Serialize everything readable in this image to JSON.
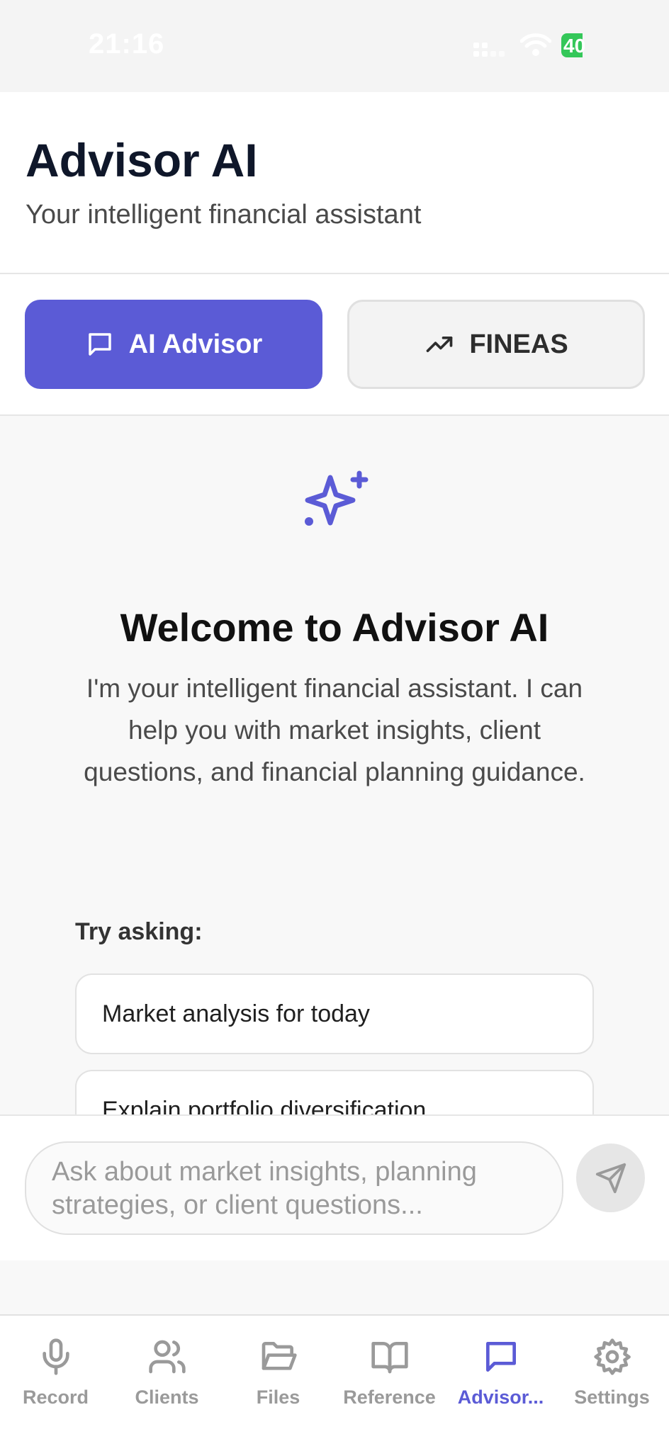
{
  "status_bar": {
    "time": "21:16",
    "battery": "40"
  },
  "header": {
    "title": "Advisor AI",
    "subtitle": "Your intelligent financial assistant"
  },
  "tabs": [
    {
      "label": "AI Advisor",
      "icon": "message-square-icon",
      "active": true
    },
    {
      "label": "FINEAS",
      "icon": "trending-up-icon",
      "active": false
    }
  ],
  "welcome": {
    "icon": "sparkle-icon",
    "title": "Welcome to Advisor AI",
    "text": "I'm your intelligent financial assistant. I can help you with market insights, client questions, and financial planning guidance."
  },
  "suggestions": {
    "label": "Try asking:",
    "items": [
      "Market analysis for today",
      "Explain portfolio diversification"
    ]
  },
  "composer": {
    "placeholder": "Ask about market insights, planning strategies, or client questions...",
    "send_icon": "send-icon"
  },
  "nav": {
    "items": [
      {
        "label": "Record",
        "icon": "mic-icon"
      },
      {
        "label": "Clients",
        "icon": "users-icon"
      },
      {
        "label": "Files",
        "icon": "folder-open-icon"
      },
      {
        "label": "Reference",
        "icon": "book-open-icon"
      },
      {
        "label": "Advisor...",
        "icon": "message-square-icon",
        "active": true
      },
      {
        "label": "Settings",
        "icon": "gear-icon"
      }
    ]
  },
  "colors": {
    "accent": "#5b5bd6",
    "title": "#0f172a",
    "muted": "#9a9a9a",
    "battery": "#34c759"
  }
}
